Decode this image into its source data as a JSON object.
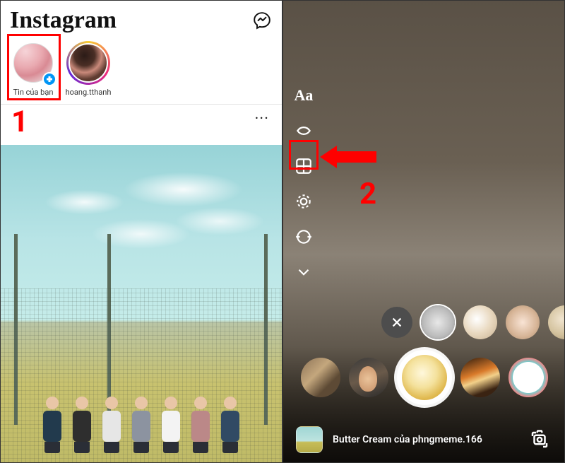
{
  "annotations": {
    "step1_label": "1",
    "step2_label": "2"
  },
  "left": {
    "brand": "Instagram",
    "stories": {
      "yours_label": "Tin của bạn",
      "friend_label": "hoang.tthanh"
    },
    "post": {
      "more_label": "..."
    }
  },
  "right": {
    "toolbar": {
      "text_tool": "Aa"
    },
    "filter_name": "Butter Cream của phngmeme.166"
  }
}
